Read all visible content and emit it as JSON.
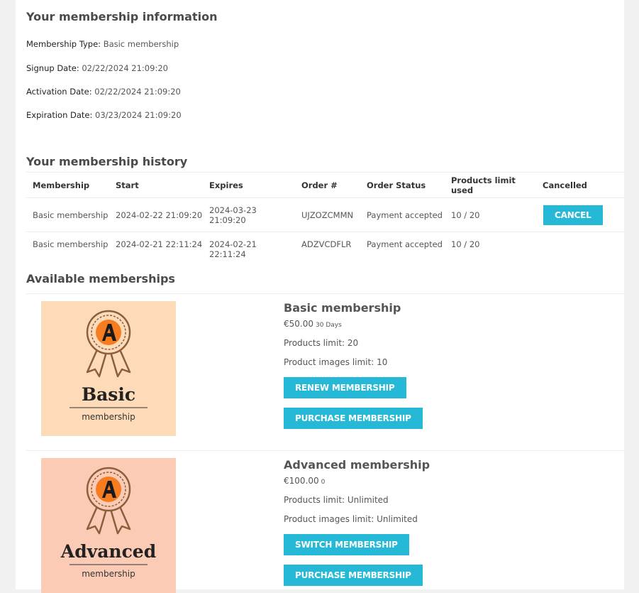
{
  "info": {
    "title": "Your membership information",
    "rows": [
      {
        "label": "Membership Type:",
        "value": "Basic membership"
      },
      {
        "label": "Signup Date:",
        "value": "02/22/2024 21:09:20"
      },
      {
        "label": "Activation Date:",
        "value": "02/22/2024 21:09:20"
      },
      {
        "label": "Expiration Date:",
        "value": "03/23/2024 21:09:20"
      }
    ]
  },
  "history": {
    "title": "Your membership history",
    "columns": [
      "Membership",
      "Start",
      "Expires",
      "Order #",
      "Order Status",
      "Products limit used",
      "Cancelled"
    ],
    "rows": [
      [
        "Basic membership",
        "2024-02-22 21:09:20",
        "2024-03-23 21:09:20",
        "UJZOZCMMN",
        "Payment accepted",
        "10 / 20"
      ],
      [
        "Basic membership",
        "2024-02-21 22:11:24",
        "2024-02-21 22:11:24",
        "ADZVCDFLR",
        "Payment accepted",
        "10 / 20"
      ]
    ],
    "cancel_label": "CANCEL"
  },
  "available": {
    "title": "Available memberships",
    "cards": [
      {
        "image_word": "Basic",
        "image_sub": "membership",
        "image_bg": "#fddbb8",
        "name": "Basic membership",
        "price": "€50.00",
        "duration": "30 Days",
        "products_limit": "Products limit: 20",
        "images_limit": "Product images limit: 10",
        "primary_button": "RENEW MEMBERSHIP",
        "purchase_button": "PURCHASE MEMBERSHIP"
      },
      {
        "image_word": "Advanced",
        "image_sub": "membership",
        "image_bg": "#fccbb5",
        "name": "Advanced membership",
        "price": "€100.00",
        "duration": "0",
        "products_limit": "Products limit: Unlimited",
        "images_limit": "Product images limit: Unlimited",
        "primary_button": "SWITCH MEMBERSHIP",
        "purchase_button": "PURCHASE MEMBERSHIP"
      }
    ]
  },
  "colors": {
    "accent": "#25b9d7",
    "badge_orange": "#f57c1f",
    "badge_outline": "#8b5e3c"
  },
  "icons": [
    "award-badge-icon"
  ]
}
